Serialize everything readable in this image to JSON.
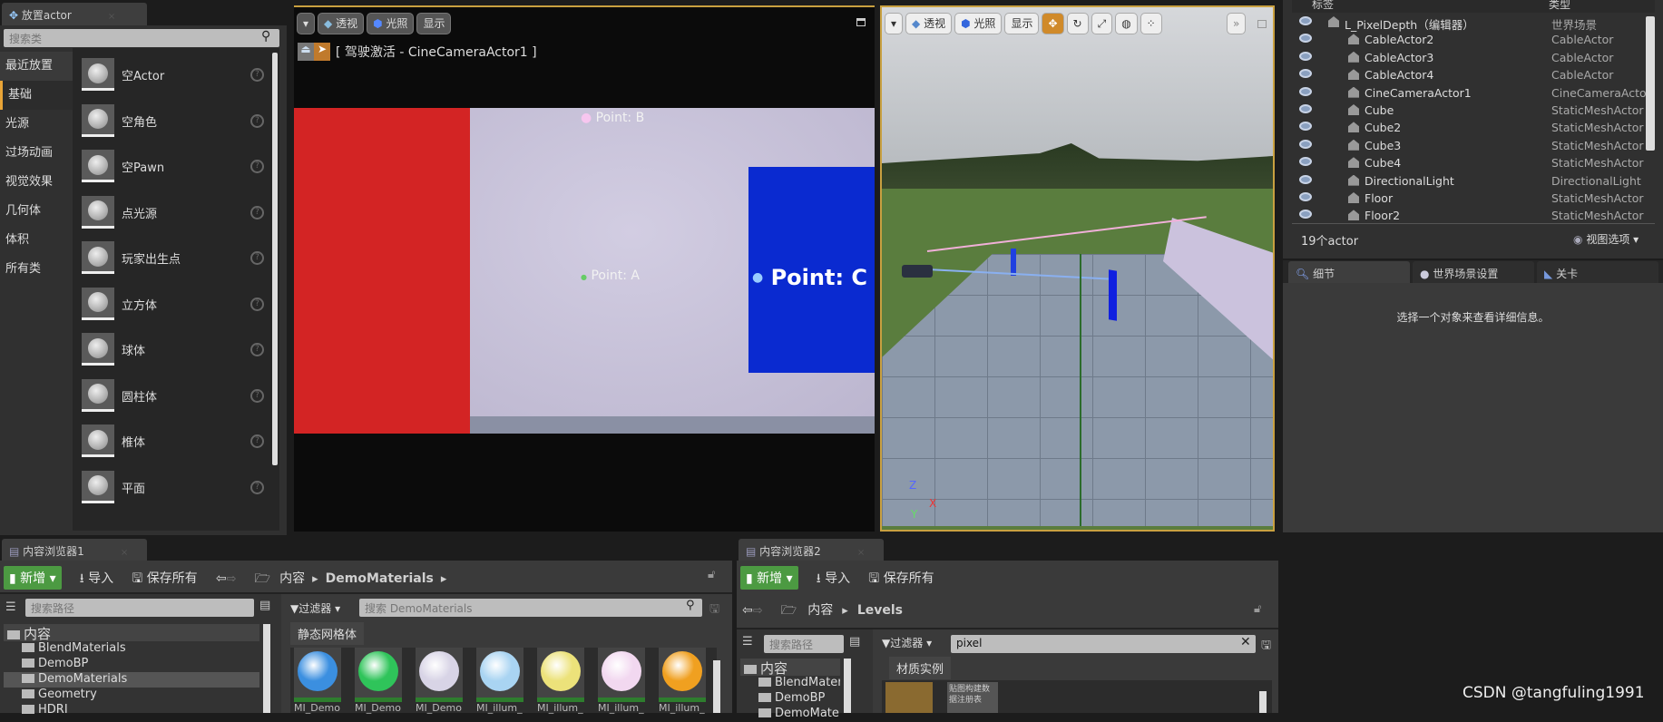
{
  "place_actor": {
    "tab": "放置actor",
    "search_placeholder": "搜索类",
    "categories": [
      "最近放置",
      "基础",
      "光源",
      "过场动画",
      "视觉效果",
      "几何体",
      "体积",
      "所有类"
    ],
    "selected_category": "基础",
    "items": [
      "空Actor",
      "空角色",
      "空Pawn",
      "点光源",
      "玩家出生点",
      "立方体",
      "球体",
      "圆柱体",
      "椎体",
      "平面"
    ]
  },
  "viewport1": {
    "perspective": "透视",
    "lighting": "光照",
    "show": "显示",
    "pilot_label": "[ 驾驶激活 - CineCameraActor1 ]",
    "points": {
      "b": "Point: B",
      "a": "Point: A",
      "c": "Point: C"
    }
  },
  "viewport2": {
    "perspective": "透视",
    "lighting": "光照",
    "show": "显示",
    "axes": {
      "z": "Z",
      "x": "X",
      "y": "Y"
    }
  },
  "outliner": {
    "col_label": "标签",
    "col_type": "类型",
    "rows": [
      {
        "name": "L_PixelDepth（编辑器）",
        "type": "世界场景"
      },
      {
        "name": "CableActor2",
        "type": "CableActor"
      },
      {
        "name": "CableActor3",
        "type": "CableActor"
      },
      {
        "name": "CableActor4",
        "type": "CableActor"
      },
      {
        "name": "CineCameraActor1",
        "type": "CineCameraActor"
      },
      {
        "name": "Cube",
        "type": "StaticMeshActor"
      },
      {
        "name": "Cube2",
        "type": "StaticMeshActor"
      },
      {
        "name": "Cube3",
        "type": "StaticMeshActor"
      },
      {
        "name": "Cube4",
        "type": "StaticMeshActor"
      },
      {
        "name": "DirectionalLight",
        "type": "DirectionalLight"
      },
      {
        "name": "Floor",
        "type": "StaticMeshActor"
      },
      {
        "name": "Floor2",
        "type": "StaticMeshActor"
      }
    ],
    "count": "19个actor",
    "view_options": "视图选项"
  },
  "details": {
    "tabs": [
      "细节",
      "世界场景设置",
      "关卡"
    ],
    "empty_message": "选择一个对象来查看详细信息。"
  },
  "cb1": {
    "tab": "内容浏览器1",
    "new": "新增",
    "import": "导入",
    "save_all": "保存所有",
    "path": [
      "内容",
      "DemoMaterials"
    ],
    "path_search": "搜索路径",
    "filter": "过滤器",
    "search_placeholder": "搜索 DemoMaterials",
    "section": "静态网格体",
    "folders": [
      "内容",
      "BlendMaterials",
      "DemoBP",
      "DemoMaterials",
      "Geometry",
      "HDRI"
    ],
    "assets": [
      {
        "name": "MI_Demo",
        "color": "#3b8fe0"
      },
      {
        "name": "MI_Demo",
        "color": "#2fc45a"
      },
      {
        "name": "MI_Demo",
        "color": "#d8d4e6"
      },
      {
        "name": "MI_illum_",
        "color": "#a9d4f2"
      },
      {
        "name": "MI_illum_",
        "color": "#ece27a"
      },
      {
        "name": "MI_illum_",
        "color": "#f2d8f0"
      },
      {
        "name": "MI_illum_",
        "color": "#f0a020"
      }
    ]
  },
  "cb2": {
    "tab": "内容浏览器2",
    "new": "新增",
    "import": "导入",
    "save_all": "保存所有",
    "path": [
      "内容",
      "Levels"
    ],
    "path_search": "搜索路径",
    "filter": "过滤器",
    "search_value": "pixel",
    "section": "材质实例",
    "folders": [
      "内容",
      "BlendMateria",
      "DemoBP",
      "DemoMateria"
    ],
    "asset_label": "贴图构建数据注册表"
  },
  "watermark": "CSDN @tangfuling1991"
}
